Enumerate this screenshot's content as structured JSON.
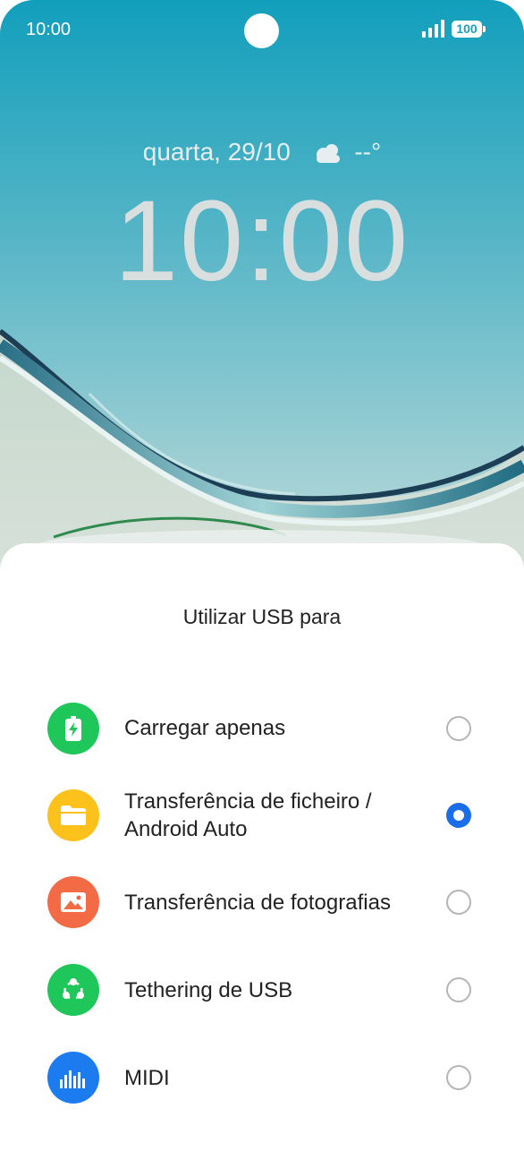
{
  "status_bar": {
    "time": "10:00",
    "battery": "100",
    "signal_icon": "signal-bars-icon"
  },
  "lock_screen": {
    "date": "quarta, 29/10",
    "weather_icon": "cloud-icon",
    "temperature": "--°",
    "clock": "10:00"
  },
  "usb_sheet": {
    "title": "Utilizar USB para",
    "options": [
      {
        "label": "Carregar apenas",
        "icon": "battery-charging-icon",
        "color": "#1fc65a",
        "selected": false
      },
      {
        "label": "Transferência de ficheiro / Android Auto",
        "icon": "folder-icon",
        "color": "#fcc21b",
        "selected": true
      },
      {
        "label": "Transferência de fotografias",
        "icon": "image-icon",
        "color": "#f26b45",
        "selected": false
      },
      {
        "label": "Tethering de USB",
        "icon": "share-nodes-icon",
        "color": "#1fc65a",
        "selected": false
      },
      {
        "label": "MIDI",
        "icon": "equalizer-icon",
        "color": "#1d7bf0",
        "selected": false
      }
    ]
  },
  "colors": {
    "accent": "#1a6fe8",
    "wallpaper_top": "#15a1bd",
    "wallpaper_bottom": "#8fc2c6"
  }
}
